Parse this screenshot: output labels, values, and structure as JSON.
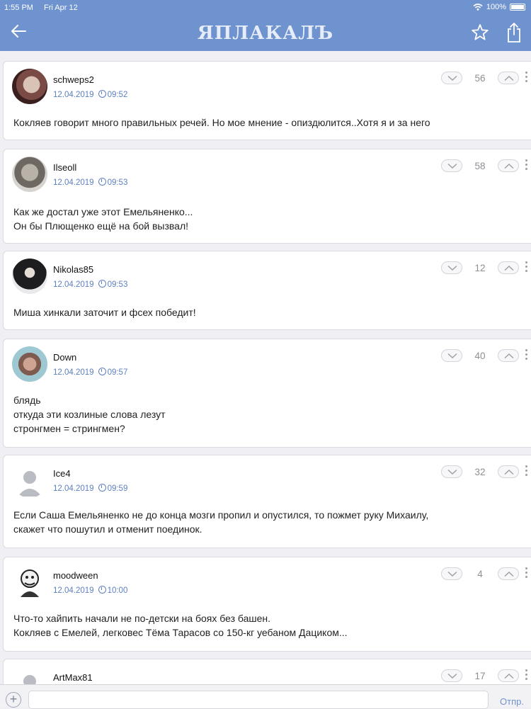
{
  "status_bar": {
    "time": "1:55 PM",
    "date": "Fri Apr 12",
    "wifi_icon": "wifi-icon",
    "battery": "100%"
  },
  "nav": {
    "logo": "ЯПЛАКАЛЪ"
  },
  "comments": [
    {
      "user": "schweps2",
      "date": "12.04.2019",
      "time": "09:52",
      "score": "56",
      "text": "Кокляев говорит много правильных речей. Но мое мнение - опиздюлится..Хотя я и за него"
    },
    {
      "user": "Ilseoll",
      "date": "12.04.2019",
      "time": "09:53",
      "score": "58",
      "text": "Как же достал уже этот Емельяненко...\nОн бы Плющенко ещё на бой вызвал!"
    },
    {
      "user": "Nikolas85",
      "date": "12.04.2019",
      "time": "09:53",
      "score": "12",
      "text": "Миша хинкали заточит и фсех победит!"
    },
    {
      "user": "Down",
      "date": "12.04.2019",
      "time": "09:57",
      "score": "40",
      "text": "блядь\nоткуда эти козлиные слова лезут\nстронгмен = стрингмен?"
    },
    {
      "user": "Ice4",
      "date": "12.04.2019",
      "time": "09:59",
      "score": "32",
      "text": "Если Саша Емельяненко не до конца мозги пропил и опустился, то пожмет руку Михаилу,\nскажет что пошутил и отменит поединок."
    },
    {
      "user": "moodween",
      "date": "12.04.2019",
      "time": "10:00",
      "score": "4",
      "text": "Что-то хайпить начали не по-детски на боях без башен.\nКокляев с Емелей,  легковес Тёма Тарасов со 150-кг уебаном Дациком..."
    },
    {
      "user": "ArtMax81",
      "date": "",
      "time": "",
      "score": "17",
      "text": ""
    }
  ],
  "reply_bar": {
    "add": "+",
    "send_label": "Отпр."
  }
}
